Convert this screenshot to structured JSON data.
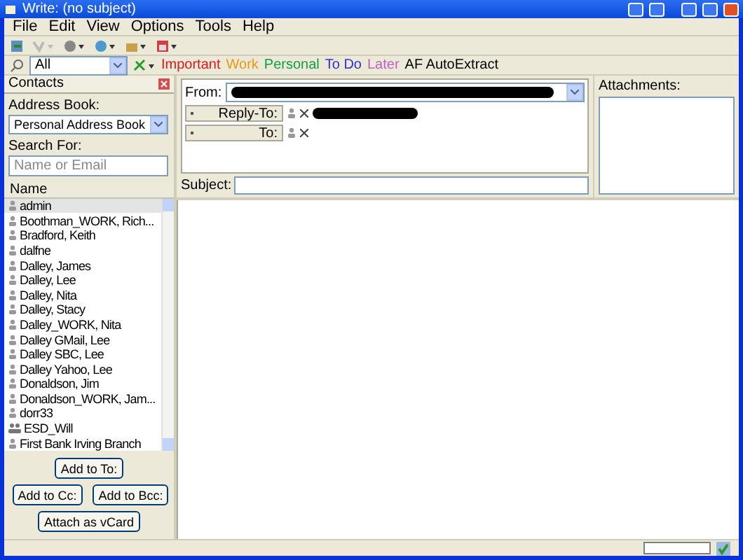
{
  "window": {
    "title": "Write: (no subject)"
  },
  "menu": [
    "File",
    "Edit",
    "View",
    "Options",
    "Tools",
    "Help"
  ],
  "filter": {
    "value": "All"
  },
  "tags": [
    {
      "label": "Important",
      "color": "#d81818"
    },
    {
      "label": "Work",
      "color": "#e89a10"
    },
    {
      "label": "Personal",
      "color": "#10a040"
    },
    {
      "label": "To Do",
      "color": "#3030d0"
    },
    {
      "label": "Later",
      "color": "#c060c0"
    },
    {
      "label": "AF AutoExtract",
      "color": "#000000"
    }
  ],
  "contacts": {
    "title": "Contacts",
    "address_book_label": "Address Book:",
    "address_book": "Personal Address Book",
    "search_label": "Search For:",
    "search_placeholder": "Name or Email",
    "column": "Name",
    "rows": [
      {
        "name": "admin",
        "kind": "contact",
        "selected": true
      },
      {
        "name": "Boothman_WORK, Rich...",
        "kind": "contact",
        "selected": false
      },
      {
        "name": "Bradford, Keith",
        "kind": "contact",
        "selected": false
      },
      {
        "name": "dalfne",
        "kind": "contact",
        "selected": false
      },
      {
        "name": "Dalley, James",
        "kind": "contact",
        "selected": false
      },
      {
        "name": "Dalley, Lee",
        "kind": "contact",
        "selected": false
      },
      {
        "name": "Dalley, Nita",
        "kind": "contact",
        "selected": false
      },
      {
        "name": "Dalley, Stacy",
        "kind": "contact",
        "selected": false
      },
      {
        "name": "Dalley_WORK, Nita",
        "kind": "contact",
        "selected": false
      },
      {
        "name": "Dalley GMail, Lee",
        "kind": "contact",
        "selected": false
      },
      {
        "name": "Dalley SBC, Lee",
        "kind": "contact",
        "selected": false
      },
      {
        "name": "Dalley Yahoo, Lee",
        "kind": "contact",
        "selected": false
      },
      {
        "name": "Donaldson, Jim",
        "kind": "contact",
        "selected": false
      },
      {
        "name": "Donaldson_WORK, Jam...",
        "kind": "contact",
        "selected": false
      },
      {
        "name": "dorr33",
        "kind": "contact",
        "selected": false
      },
      {
        "name": "ESD_Will",
        "kind": "group",
        "selected": false
      },
      {
        "name": "First Bank   Irving Branch",
        "kind": "contact",
        "selected": false
      }
    ],
    "buttons": [
      "Add to To:",
      "Add to Cc:",
      "Add to Bcc:",
      "Attach as vCard"
    ]
  },
  "compose": {
    "from_label": "From:",
    "address_rows": [
      "Reply-To:",
      "To:"
    ],
    "subject_label": "Subject:",
    "attachments_label": "Attachments:"
  }
}
